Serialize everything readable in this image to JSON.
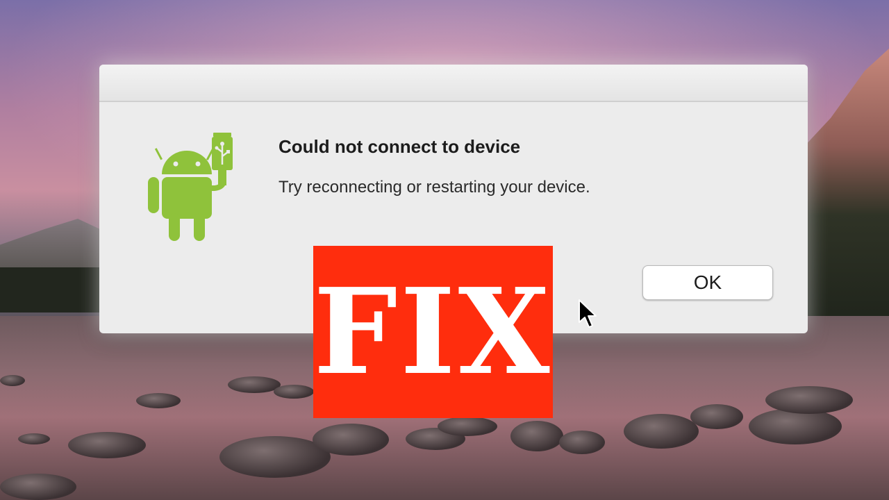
{
  "dialog": {
    "title": "Could not connect to device",
    "message": "Try reconnecting or restarting your device.",
    "ok_label": "OK",
    "icon": "android-usb-icon"
  },
  "overlay": {
    "badge_text": "FIX",
    "badge_color": "#ff2d0d"
  },
  "colors": {
    "android_green": "#8fc23b",
    "dialog_bg": "#ececec"
  }
}
